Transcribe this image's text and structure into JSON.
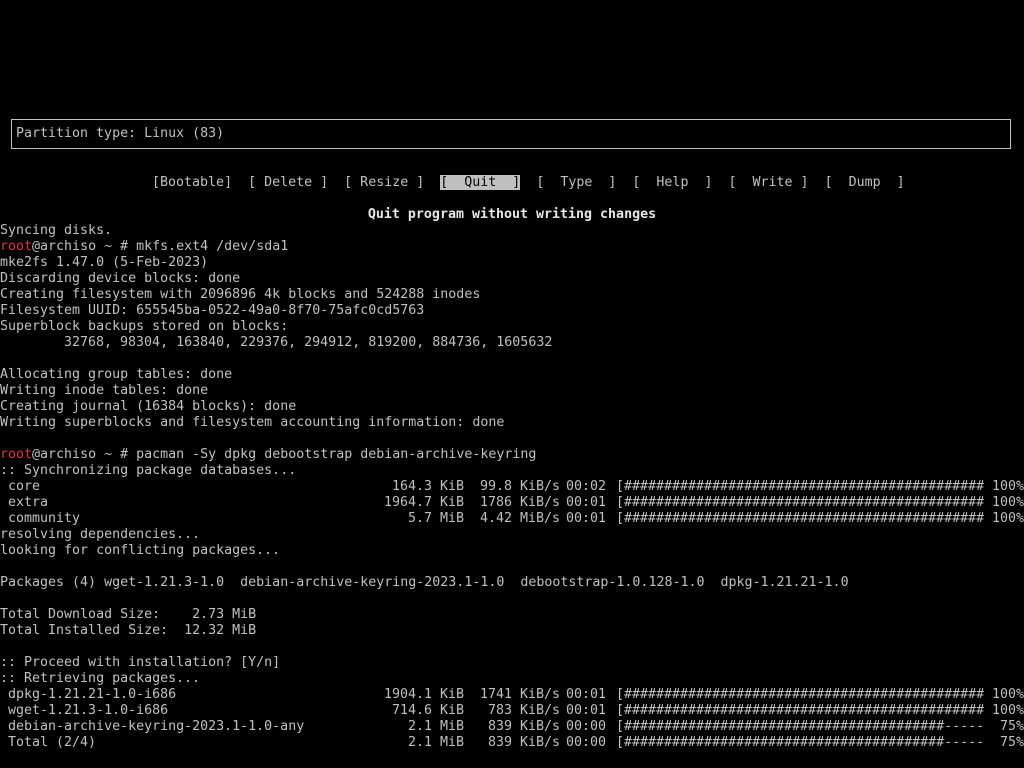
{
  "colors": {
    "background": "#000000",
    "text": "#c0c0c0",
    "root_user": "#e33636",
    "selected_bg": "#c0c0c0"
  },
  "cfdisk": {
    "partition_type": "Partition type: Linux (83)",
    "menu": [
      {
        "label": "[Bootable]",
        "selected": false
      },
      {
        "label": "[ Delete ]",
        "selected": false
      },
      {
        "label": "[ Resize ]",
        "selected": false
      },
      {
        "label": "[  Quit  ]",
        "selected": true
      },
      {
        "label": "[  Type  ]",
        "selected": false
      },
      {
        "label": "[  Help  ]",
        "selected": false
      },
      {
        "label": "[  Write ]",
        "selected": false
      },
      {
        "label": "[  Dump  ]",
        "selected": false
      }
    ],
    "status": "Quit program without writing changes"
  },
  "terminal": {
    "syncing": "Syncing disks.",
    "prompt_user": "root",
    "prompt_host": "@archiso ~ # ",
    "cmd_mkfs": "mkfs.ext4 /dev/sda1",
    "mkfs_lines": [
      "mke2fs 1.47.0 (5-Feb-2023)",
      "Discarding device blocks: done",
      "Creating filesystem with 2096896 4k blocks and 524288 inodes",
      "Filesystem UUID: 655545ba-0522-49a0-8f70-75afc0cd5763",
      "Superblock backups stored on blocks:"
    ],
    "superblock_backups": "32768, 98304, 163840, 229376, 294912, 819200, 884736, 1605632",
    "mkfs_lines_2": [
      "Allocating group tables: done",
      "Writing inode tables: done",
      "Creating journal (16384 blocks): done",
      "Writing superblocks and filesystem accounting information: done"
    ],
    "cmd_pacman": "pacman -Sy dpkg debootstrap debian-archive-keyring",
    "sync_header": ":: Synchronizing package databases...",
    "db_rows": [
      {
        "name": "core",
        "size": "164.3 KiB",
        "speed": " 99.8 KiB/s",
        "time": "00:02",
        "bar": "[######################################################]",
        "pct": "100%"
      },
      {
        "name": "extra",
        "size": "1964.7 KiB",
        "speed": " 1786 KiB/s",
        "time": "00:01",
        "bar": "[######################################################]",
        "pct": "100%"
      },
      {
        "name": "community",
        "size": "5.7 MiB",
        "speed": " 4.42 MiB/s",
        "time": "00:01",
        "bar": "[######################################################]",
        "pct": "100%"
      }
    ],
    "resolving": "resolving dependencies...",
    "conflicts": "looking for conflicting packages...",
    "packages": "Packages (4) wget-1.21.3-1.0  debian-archive-keyring-2023.1-1.0  debootstrap-1.0.128-1.0  dpkg-1.21.21-1.0",
    "download_size": "Total Download Size:    2.73 MiB",
    "installed_size": "Total Installed Size:  12.32 MiB",
    "proceed": ":: Proceed with installation? [Y/n]",
    "retrieving": ":: Retrieving packages...",
    "pkg_rows": [
      {
        "name": "dpkg-1.21.21-1.0-i686",
        "size": "1904.1 KiB",
        "speed": " 1741 KiB/s",
        "time": "00:01",
        "bar": "[######################################################]",
        "pct": "100%"
      },
      {
        "name": "wget-1.21.3-1.0-i686",
        "size": "714.6 KiB",
        "speed": "  783 KiB/s",
        "time": "00:01",
        "bar": "[######################################################]",
        "pct": "100%"
      },
      {
        "name": "debian-archive-keyring-2023.1-1.0-any",
        "size": "2.1 MiB",
        "speed": "  839 KiB/s",
        "time": "00:00",
        "bar": "[########################################--------------]",
        "pct": " 75%"
      },
      {
        "name": "Total (2/4)",
        "size": "2.1 MiB",
        "speed": "  839 KiB/s",
        "time": "00:00",
        "bar": "[########################################--------------]",
        "pct": " 75%"
      }
    ]
  }
}
